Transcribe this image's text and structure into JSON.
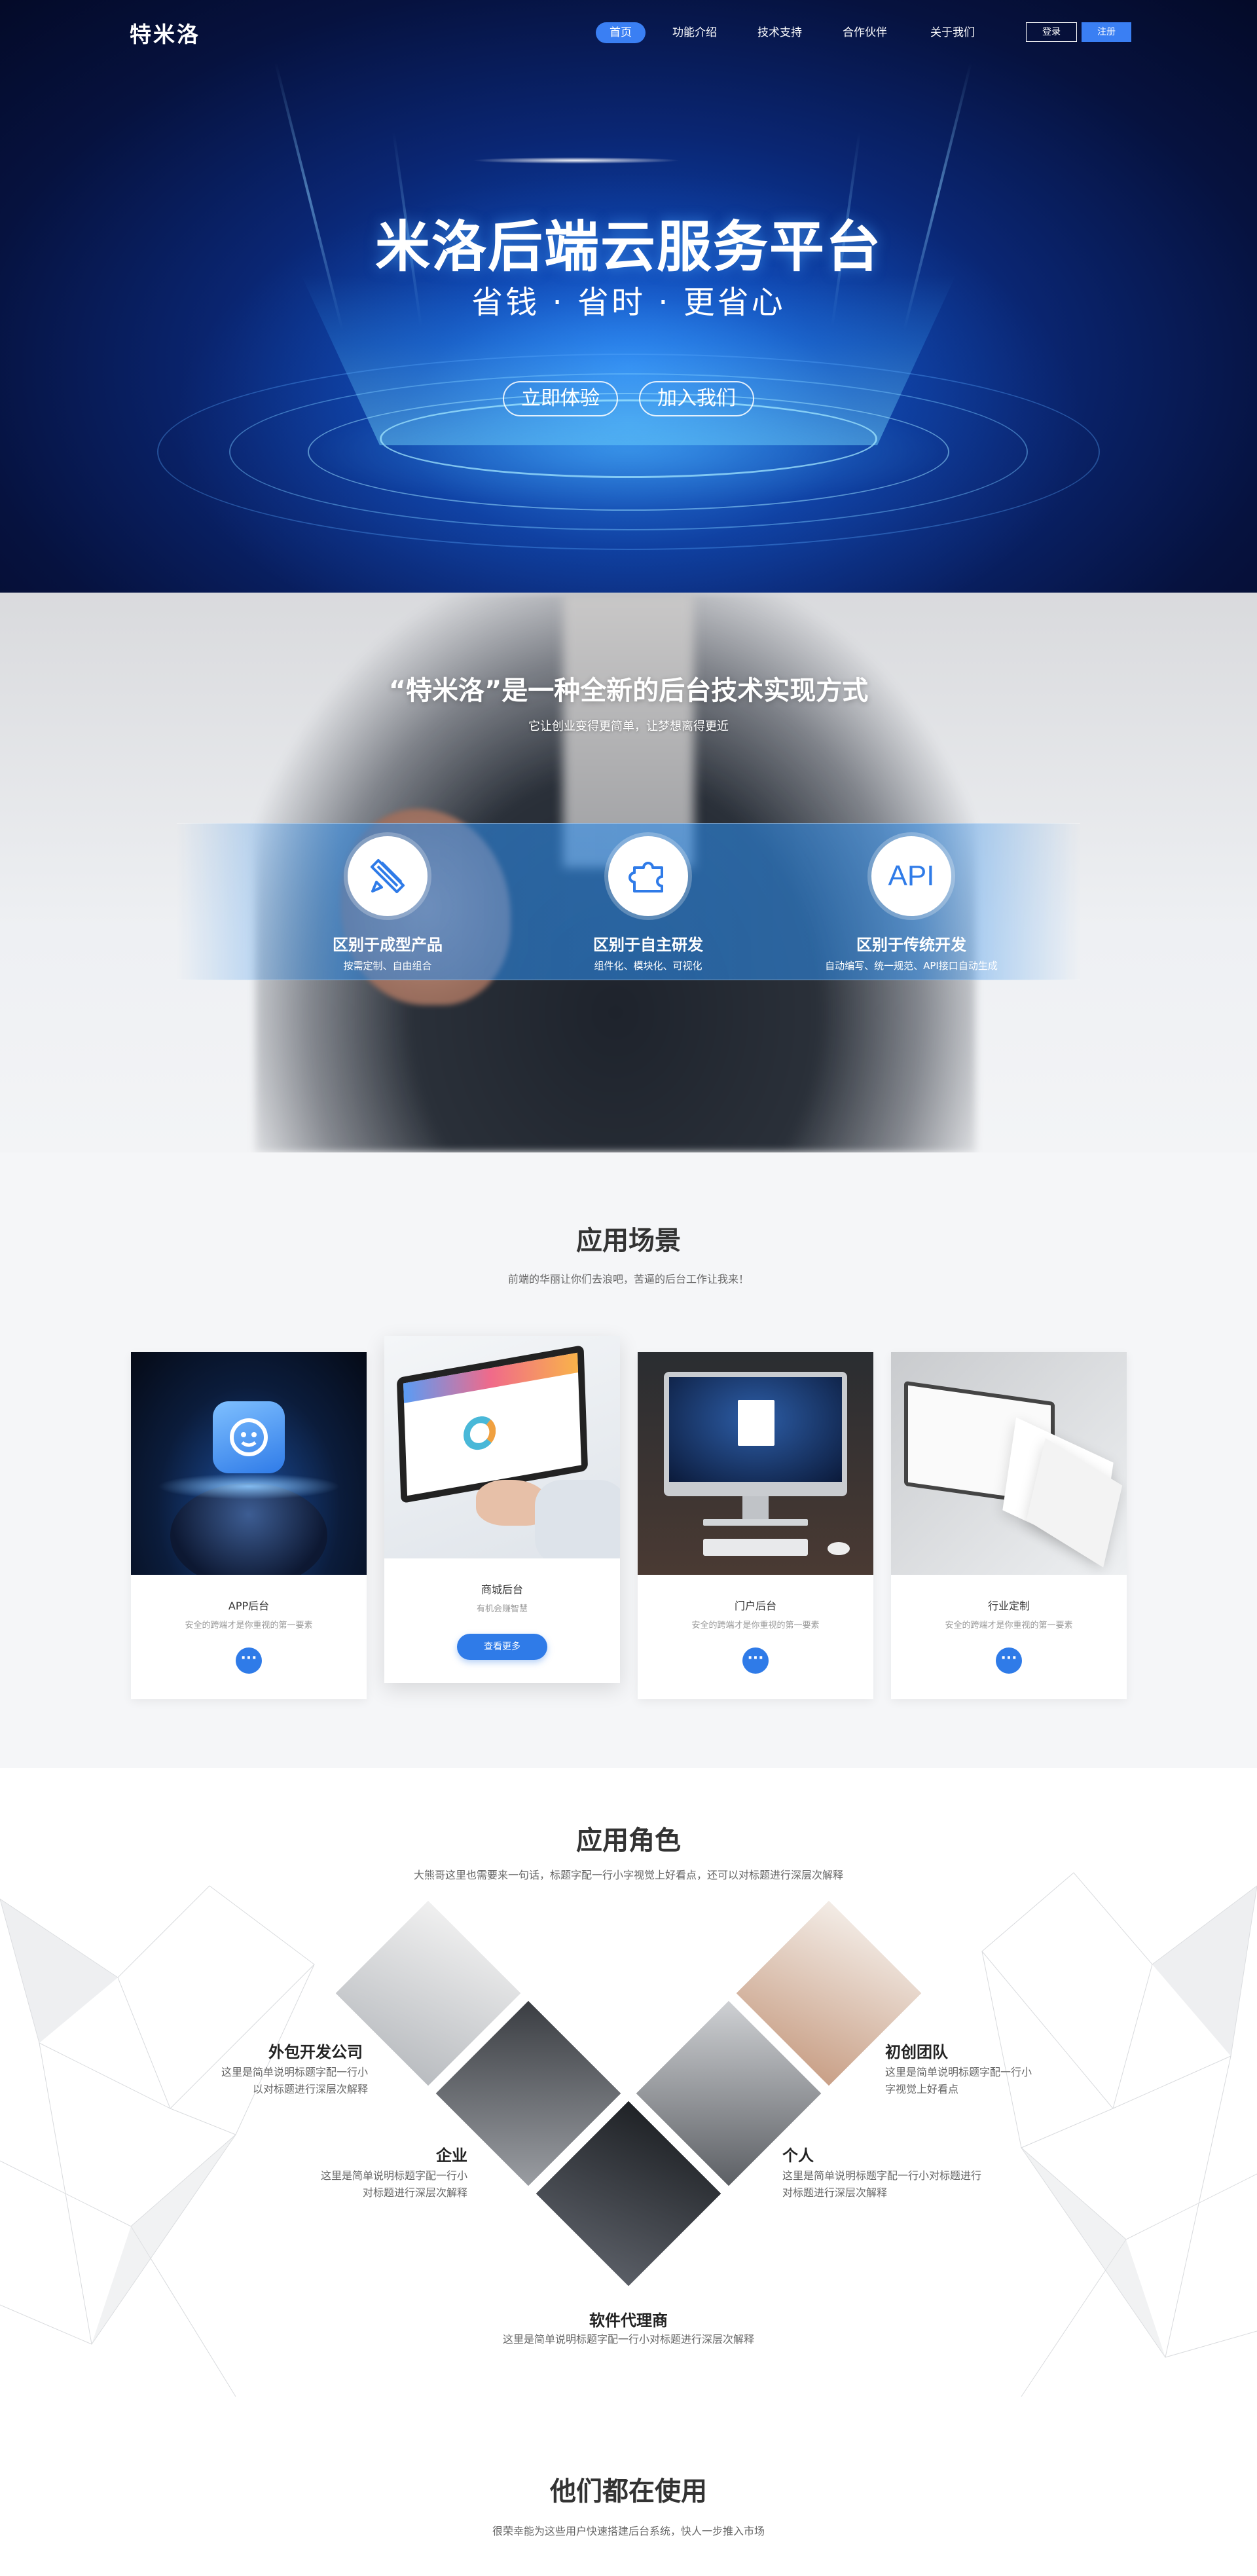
{
  "nav": {
    "logo": "特米洛",
    "items": [
      "首页",
      "功能介绍",
      "技术支持",
      "合作伙伴",
      "关于我们"
    ],
    "login": "登录",
    "register": "注册",
    "accent": "#3a7ff3"
  },
  "hero": {
    "title": "米洛后端云服务平台",
    "subtitle": "省钱 · 省时 · 更省心",
    "btn_try": "立即体验",
    "btn_join": "加入我们"
  },
  "intro": {
    "title": "“特米洛”是一种全新的后台技术实现方式",
    "subtitle": "它让创业变得更简单，让梦想离得更近",
    "features": [
      {
        "icon": "pencil-ruler-icon",
        "title": "区别于成型产品",
        "desc": "按需定制、自由组合"
      },
      {
        "icon": "puzzle-icon",
        "title": "区别于自主研发",
        "desc": "组件化、模块化、可视化"
      },
      {
        "icon": "api-icon",
        "icon_text": "API",
        "title": "区别于传统开发",
        "desc": "自动编写、统一规范、API接口自动生成"
      }
    ]
  },
  "scenarios": {
    "title": "应用场景",
    "subtitle": "前端的华丽让你们去浪吧，苦逼的后台工作让我来！",
    "cards": [
      {
        "title": "APP后台",
        "desc": "安全的跨端才是你重视的第一要素",
        "action": "···"
      },
      {
        "title": "商城后台",
        "desc": "有机会赚智慧",
        "action": "查看更多"
      },
      {
        "title": "门户后台",
        "desc": "安全的跨端才是你重视的第一要素",
        "action": "···"
      },
      {
        "title": "行业定制",
        "desc": "安全的跨端才是你重视的第一要素",
        "action": "···"
      }
    ]
  },
  "roles": {
    "title": "应用角色",
    "subtitle": "大熊哥这里也需要来一句话，标题字配一行小字视觉上好看点，还可以对标题进行深层次解释",
    "items": [
      {
        "title": "外包开发公司",
        "desc1": "这里是简单说明标题字配一行小",
        "desc2": "以对标题进行深层次解释"
      },
      {
        "title": "初创团队",
        "desc1": "这里是简单说明标题字配一行小",
        "desc2": "字视觉上好看点"
      },
      {
        "title": "企业",
        "desc1": "这里是简单说明标题字配一行小",
        "desc2": "对标题进行深层次解释"
      },
      {
        "title": "个人",
        "desc1": "这里是简单说明标题字配一行小对标题进行",
        "desc2": "对标题进行深层次解释"
      },
      {
        "title": "软件代理商",
        "desc1": "这里是简单说明标题字配一行小对标题进行深层次解释",
        "desc2": ""
      }
    ]
  },
  "users": {
    "title": "他们都在使用",
    "subtitle": "很荣幸能为这些用户快速搭建后台系统，快人一步推入市场"
  }
}
